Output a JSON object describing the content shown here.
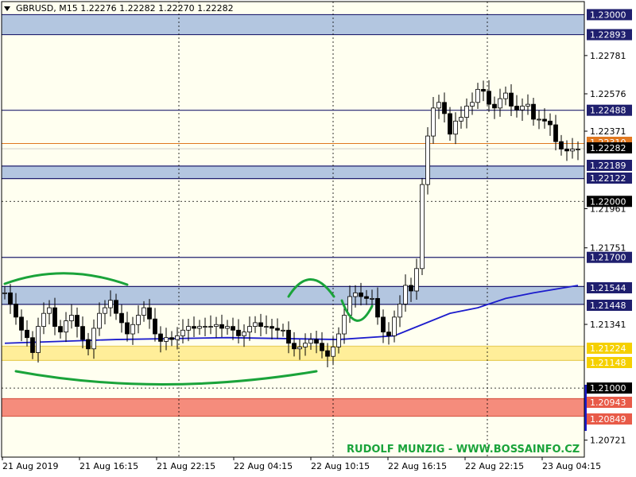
{
  "header": {
    "symbol_line": "GBRUSD, M15 1.22276 1.22282 1.22270 1.22282"
  },
  "watermark": "RUDOLF MUNZIG - WWW.BOSSAINFO.CZ",
  "colors": {
    "background": "#fffff0",
    "zone_blue": "#b3c6e0",
    "zone_yellow": "#ffee99",
    "zone_red": "#f58c7c",
    "line_navy": "#1f1f6e",
    "moving_average": "#1c1ccc",
    "annotation_green": "#1aa33a",
    "current_price_line": "#e07820"
  },
  "chart_data": {
    "type": "candlestick",
    "instrument": "GBPUSD",
    "timeframe": "M15",
    "ohlc_last": {
      "open": 1.22276,
      "high": 1.22282,
      "low": 1.2227,
      "close": 1.22282
    },
    "ylim": [
      1.2063,
      1.2307
    ],
    "x_tick_labels": [
      "21 Aug 2019",
      "21 Aug 16:15",
      "21 Aug 22:15",
      "22 Aug 04:15",
      "22 Aug 10:15",
      "22 Aug 16:15",
      "22 Aug 22:15",
      "23 Aug 04:15"
    ],
    "y_tick_labels": [
      "1.23000",
      "1.22893",
      "1.22781",
      "1.22576",
      "1.22488",
      "1.22371",
      "1.22310",
      "1.22282",
      "1.22189",
      "1.22122",
      "1.22000",
      "1.21961",
      "1.21751",
      "1.21700",
      "1.21544",
      "1.21448",
      "1.21341",
      "1.21224",
      "1.21148",
      "1.21000",
      "1.20943",
      "1.20849",
      "1.20721"
    ],
    "highlighted_labels": {
      "boxed_navy": [
        "1.23000",
        "1.22893",
        "1.22488",
        "1.22189",
        "1.22122",
        "1.21700",
        "1.21544",
        "1.21448"
      ],
      "boxed_yellow": [
        "1.21224",
        "1.21148"
      ],
      "boxed_red": [
        "1.20943",
        "1.20849"
      ],
      "boxed_black": [
        "1.22000",
        "1.21000"
      ],
      "current_price": "1.22282",
      "marker_line": "1.22310"
    },
    "zones": [
      {
        "type": "resistance",
        "color": "blue",
        "from": 1.22893,
        "to": 1.23
      },
      {
        "type": "support",
        "color": "blue",
        "from": 1.22122,
        "to": 1.22189
      },
      {
        "type": "support",
        "color": "blue",
        "from": 1.21448,
        "to": 1.21544
      },
      {
        "type": "support",
        "color": "yellow",
        "from": 1.21148,
        "to": 1.21224
      },
      {
        "type": "support",
        "color": "red",
        "from": 1.20849,
        "to": 1.20943
      }
    ],
    "horizontal_lines": [
      1.22488,
      1.217
    ],
    "round_levels": [
      1.22,
      1.21
    ],
    "close_series": [
      1.2151,
      1.2145,
      1.2138,
      1.2131,
      1.2127,
      1.2119,
      1.2133,
      1.214,
      1.2143,
      1.2133,
      1.213,
      1.2136,
      1.2139,
      1.2133,
      1.2126,
      1.2121,
      1.2132,
      1.214,
      1.2143,
      1.2147,
      1.214,
      1.2135,
      1.2129,
      1.2134,
      1.2139,
      1.2143,
      1.2137,
      1.2129,
      1.2125,
      1.2127,
      1.2126,
      1.2128,
      1.2131,
      1.2133,
      1.2132,
      1.2133,
      1.2133,
      1.2133,
      1.2134,
      1.2132,
      1.2133,
      1.2131,
      1.2128,
      1.213,
      1.2133,
      1.2135,
      1.2133,
      1.2133,
      1.2132,
      1.2131,
      1.2131,
      1.2124,
      1.2121,
      1.2122,
      1.2124,
      1.2126,
      1.2124,
      1.212,
      1.2117,
      1.2122,
      1.2129,
      1.2139,
      1.2149,
      1.2151,
      1.2149,
      1.2148,
      1.2148,
      1.2138,
      1.213,
      1.2128,
      1.2138,
      1.2145,
      1.2155,
      1.2152,
      1.2164,
      1.2209,
      1.2235,
      1.225,
      1.2253,
      1.2247,
      1.2236,
      1.2243,
      1.2245,
      1.2251,
      1.2253,
      1.226,
      1.2259,
      1.2252,
      1.225,
      1.2255,
      1.2258,
      1.2251,
      1.2249,
      1.2251,
      1.2252,
      1.2244,
      1.2244,
      1.2243,
      1.2241,
      1.2232,
      1.2228,
      1.2227,
      1.2228,
      1.2228
    ],
    "moving_average": [
      [
        0,
        1.2124
      ],
      [
        20,
        1.2126
      ],
      [
        40,
        1.2127
      ],
      [
        60,
        1.2126
      ],
      [
        70,
        1.2128
      ],
      [
        75,
        1.2134
      ],
      [
        80,
        1.214
      ],
      [
        85,
        1.2143
      ],
      [
        90,
        1.2148
      ],
      [
        95,
        1.2151
      ],
      [
        103,
        1.2155
      ]
    ]
  }
}
